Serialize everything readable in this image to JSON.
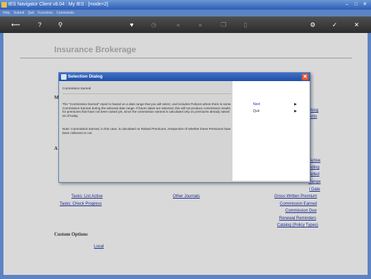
{
  "window": {
    "title": "IES Navigator Client v8.04 : My IES : [mode=2]"
  },
  "menu": [
    "Help",
    "Submit",
    "Quit",
    "Functions",
    "Commands"
  ],
  "page": {
    "heading": "Insurance Brokerage"
  },
  "dialog": {
    "title": "Selection Dialog",
    "subtitle": "Commission Earned",
    "paragraph1": "The \"Commission Earned\" report is based on a date range that you will select, and includes Policies where there is some Commission Earned during the selected date range. If future dates are selected, this will not produce commission results for premiums that have not been raised yet, since the commission earned is calculated only on premiums already raised as of today.",
    "paragraph2": "Note: Commission Earned, in this case, is calculated on Raised Premiums, irrespective of whether these Premiums have been collected or not.",
    "options": {
      "next": "Next",
      "quit": "Quit"
    }
  },
  "links": {
    "hidden_m": "M",
    "hidden_a": "A",
    "right1": "ching",
    "right2": "ments",
    "right3": "Active",
    "right4": "nding",
    "right5": "celled",
    "right6": "Range",
    "right7": "l Date",
    "tasks_list_active": "Tasks: List Active",
    "tasks_check_progress": "Tasks: Check Progress",
    "other_journals": "Other Journals",
    "gross_written_premium": "Gross Written Premium",
    "commission_earned": "Commission Earned",
    "commission_due": "Commission Due",
    "renewal_reminders": "Renewal Reminders",
    "catalog_policy_types": "Catalog (Policy Types)",
    "custom_options": "Custom Options",
    "local": "Local"
  },
  "icons": [
    "back-icon",
    "help-icon",
    "search-icon",
    "heart-icon",
    "clock-icon",
    "rewind-icon",
    "forward-icon",
    "copy-icon",
    "page-icon",
    "settings-icon",
    "check-icon",
    "close-icon"
  ]
}
